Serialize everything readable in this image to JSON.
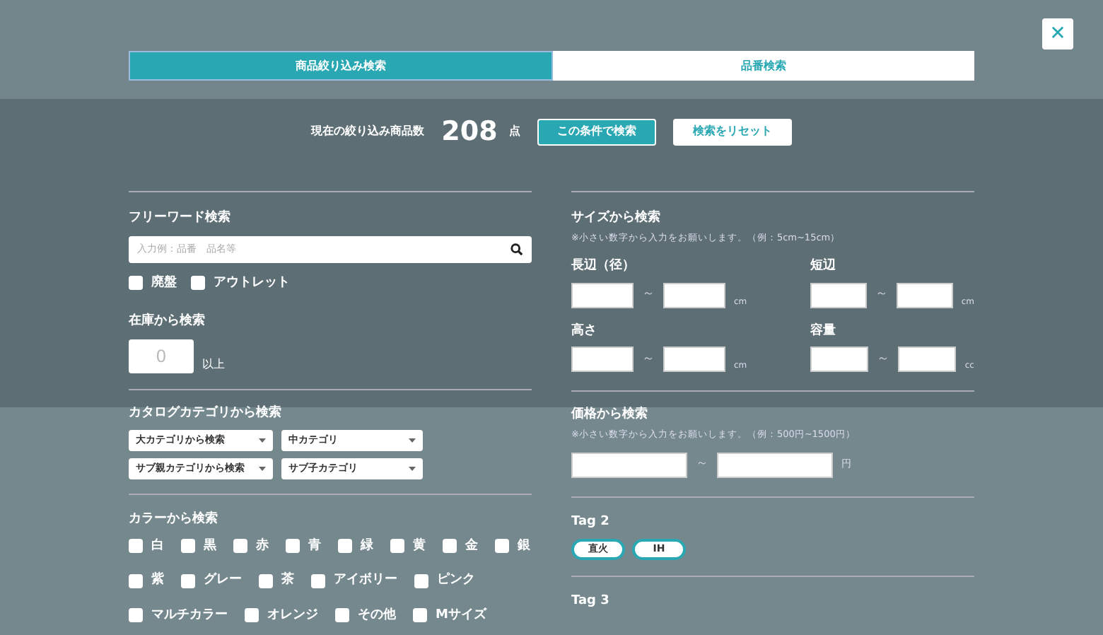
{
  "close_button": {
    "label": "✕"
  },
  "tabs": [
    {
      "label": "商品絞り込み検索",
      "selected": true
    },
    {
      "label": "品番検索",
      "selected": false
    }
  ],
  "summary": {
    "label": "現在の絞り込み商品数",
    "count": "208",
    "unit": "点"
  },
  "actions": [
    {
      "label": "この条件で検索",
      "kind": "primary"
    },
    {
      "label": "検索をリセット",
      "kind": "secondary"
    }
  ],
  "free_word": {
    "title": "フリーワード検索",
    "placeholder": "入力例：品番　品名等",
    "options": [
      {
        "label": "廃盤",
        "checked": false
      },
      {
        "label": "アウトレット",
        "checked": false
      }
    ]
  },
  "stock": {
    "title": "在庫から検索",
    "placeholder": "0",
    "suffix": "以上"
  },
  "catalog": {
    "title": "カタログカテゴリから検索",
    "selects": [
      "大カテゴリから検索",
      "中カテゴリ",
      "サブ親カテゴリから検索",
      "サブ子カテゴリ"
    ]
  },
  "colors": {
    "title": "カラーから検索",
    "lines": [
      {
        "options": [
          {
            "label": "白",
            "checked": false
          },
          {
            "label": "黒",
            "checked": false
          },
          {
            "label": "赤",
            "checked": false
          },
          {
            "label": "青",
            "checked": false
          },
          {
            "label": "緑",
            "checked": false
          },
          {
            "label": "黄",
            "checked": false
          },
          {
            "label": "金",
            "checked": false
          },
          {
            "label": "銀",
            "checked": false
          }
        ]
      },
      {
        "options": [
          {
            "label": "紫",
            "checked": false
          },
          {
            "label": "グレー",
            "checked": false
          },
          {
            "label": "茶",
            "checked": false
          },
          {
            "label": "アイボリー",
            "checked": false
          },
          {
            "label": "ピンク",
            "checked": false
          }
        ]
      },
      {
        "options": [
          {
            "label": "マルチカラー",
            "checked": false
          },
          {
            "label": "オレンジ",
            "checked": false
          },
          {
            "label": "その他",
            "checked": false
          },
          {
            "label": "Mサイズ",
            "checked": false
          }
        ]
      }
    ]
  },
  "size": {
    "title": "サイズから検索",
    "note": "※小さい数字から入力をお願いします。（例：5cm~15cm）",
    "fields": [
      {
        "label": "長辺（径）",
        "unit": "cm"
      },
      {
        "label": "短辺",
        "unit": "cm"
      },
      {
        "label": "高さ",
        "unit": "cm"
      },
      {
        "label": "容量",
        "unit": "cc"
      }
    ],
    "separator": "～"
  },
  "price": {
    "title": "価格から検索",
    "note": "※小さい数字から入力をお願いします。（例：500円~1500円）",
    "separator": "～",
    "unit": "円"
  },
  "tag2": {
    "title": "Tag 2",
    "tags": [
      {
        "label": "直火",
        "selected": false
      },
      {
        "label": "IH",
        "selected": false
      }
    ]
  },
  "tag3": {
    "title": "Tag 3"
  }
}
